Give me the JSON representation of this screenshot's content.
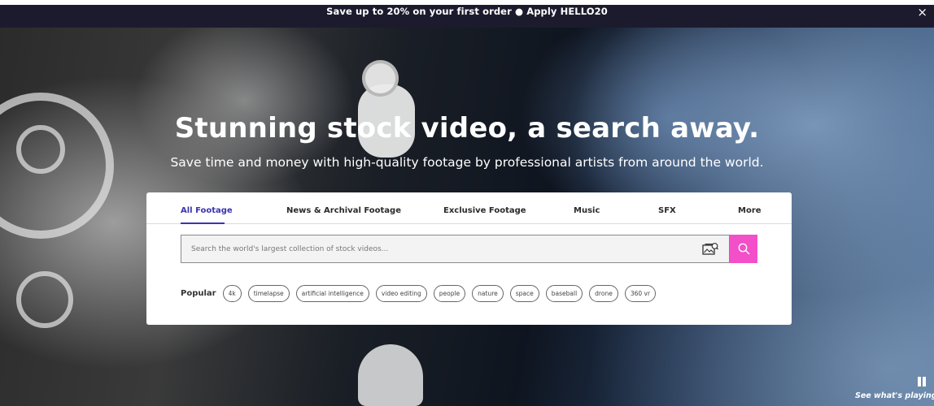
{
  "promo": {
    "text": "Save up to 20% on your first order ● Apply  HELLO20",
    "close_icon": "×"
  },
  "hero": {
    "headline": "Stunning stock video, a search away.",
    "subheadline": "Save time and money with high-quality footage by professional artists from around the world."
  },
  "tabs": [
    {
      "label": "All Footage",
      "active": true
    },
    {
      "label": "News & Archival Footage",
      "active": false
    },
    {
      "label": "Exclusive Footage",
      "active": false
    },
    {
      "label": "Music",
      "active": false
    },
    {
      "label": "SFX",
      "active": false
    },
    {
      "label": "More",
      "active": false
    }
  ],
  "search": {
    "placeholder": "Search the world's largest collection of stock videos...",
    "value": ""
  },
  "popular": {
    "label": "Popular",
    "chips": [
      "4k",
      "timelapse",
      "artificial intelligence",
      "video editing",
      "people",
      "nature",
      "space",
      "baseball",
      "drone",
      "360 vr"
    ]
  },
  "player": {
    "see_playing": "See what's playing"
  },
  "colors": {
    "promo_bg": "#1c1b2e",
    "accent": "#3b35b0",
    "search_button": "#f24fc9"
  },
  "icons": {
    "close": "close-icon",
    "visual_search": "image-search-icon",
    "search": "search-icon",
    "pause": "pause-icon"
  }
}
